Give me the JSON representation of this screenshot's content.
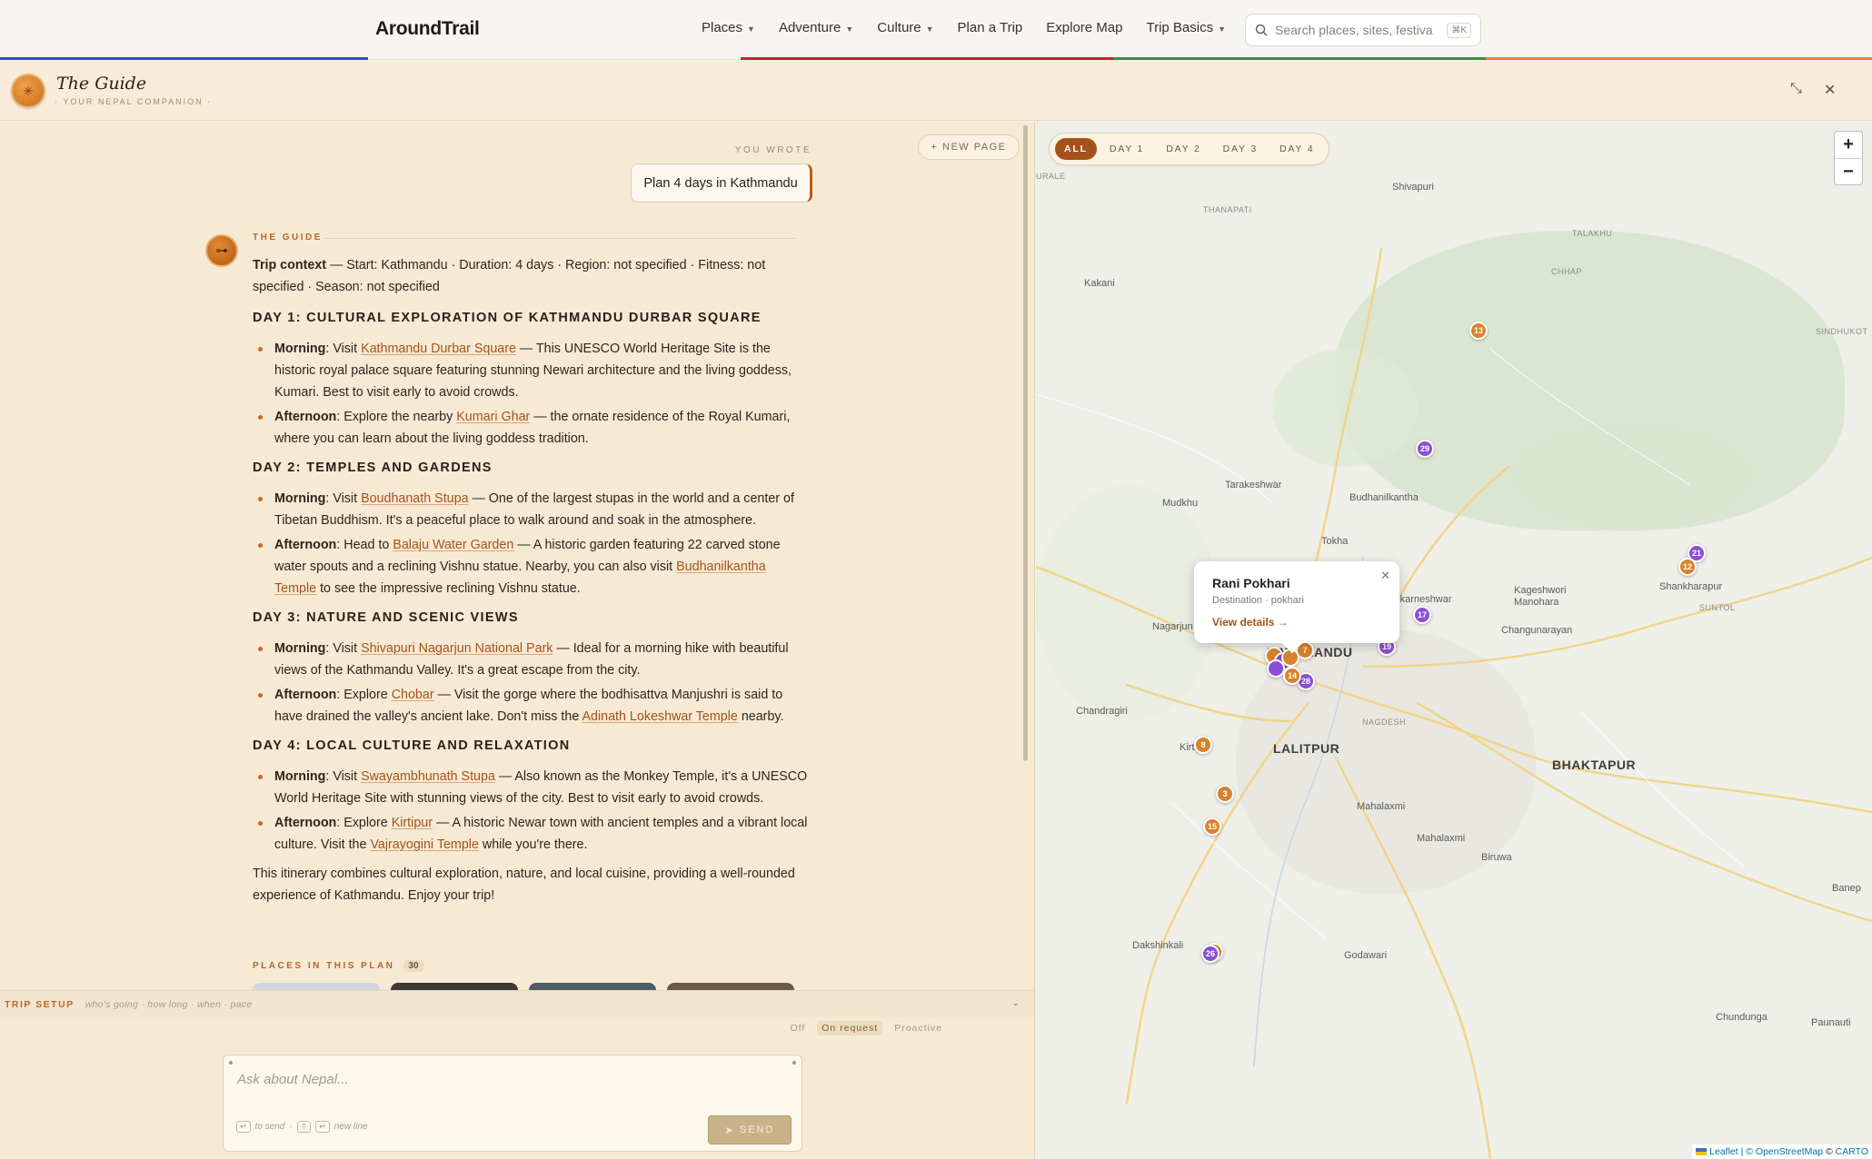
{
  "header": {
    "logo": "AroundTrail",
    "nav": [
      {
        "label": "Places",
        "dropdown": true
      },
      {
        "label": "Adventure",
        "dropdown": true
      },
      {
        "label": "Culture",
        "dropdown": true
      },
      {
        "label": "Plan a Trip",
        "dropdown": false
      },
      {
        "label": "Explore Map",
        "dropdown": false
      },
      {
        "label": "Trip Basics",
        "dropdown": true
      }
    ],
    "search_placeholder": "Search places, sites, festiva",
    "search_shortcut": "⌘K"
  },
  "guide_panel": {
    "title": "The Guide",
    "subtitle": "· YOUR NEPAL COMPANION ·",
    "new_page_label": "+ NEW PAGE",
    "you_wrote_label": "YOU WROTE",
    "user_message": "Plan 4 days in Kathmandu",
    "guide_label": "THE GUIDE"
  },
  "reply": {
    "context_label": "Trip context",
    "context_text": " — Start: Kathmandu · Duration: 4 days · Region: not specified · Fitness: not specified · Season: not specified",
    "days": [
      {
        "heading": "DAY 1: CULTURAL EXPLORATION OF KATHMANDU DURBAR SQUARE",
        "items": [
          {
            "when": "Morning",
            "pre": ": Visit ",
            "link": "Kathmandu Durbar Square",
            "post": " — This UNESCO World Heritage Site is the historic royal palace square featuring stunning Newari architecture and the living goddess, Kumari. Best to visit early to avoid crowds.",
            "link2": "",
            "post2": ""
          },
          {
            "when": "Afternoon",
            "pre": ": Explore the nearby ",
            "link": "Kumari Ghar",
            "post": " — the ornate residence of the Royal Kumari, where you can learn about the living goddess tradition.",
            "link2": "",
            "post2": ""
          }
        ]
      },
      {
        "heading": "DAY 2: TEMPLES AND GARDENS",
        "items": [
          {
            "when": "Morning",
            "pre": ": Visit ",
            "link": "Boudhanath Stupa",
            "post": " — One of the largest stupas in the world and a center of Tibetan Buddhism. It's a peaceful place to walk around and soak in the atmosphere.",
            "link2": "",
            "post2": ""
          },
          {
            "when": "Afternoon",
            "pre": ": Head to ",
            "link": "Balaju Water Garden",
            "post": " — A historic garden featuring 22 carved stone water spouts and a reclining Vishnu statue. Nearby, you can also visit ",
            "link2": "Budhanilkantha Temple",
            "post2": " to see the impressive reclining Vishnu statue."
          }
        ]
      },
      {
        "heading": "DAY 3: NATURE AND SCENIC VIEWS",
        "items": [
          {
            "when": "Morning",
            "pre": ": Visit ",
            "link": "Shivapuri Nagarjun National Park",
            "post": " — Ideal for a morning hike with beautiful views of the Kathmandu Valley. It's a great escape from the city.",
            "link2": "",
            "post2": ""
          },
          {
            "when": "Afternoon",
            "pre": ": Explore ",
            "link": "Chobar",
            "post": " — Visit the gorge where the bodhisattva Manjushri is said to have drained the valley's ancient lake. Don't miss the ",
            "link2": "Adinath Lokeshwar Temple",
            "post2": " nearby."
          }
        ]
      },
      {
        "heading": "DAY 4: LOCAL CULTURE AND RELAXATION",
        "items": [
          {
            "when": "Morning",
            "pre": ": Visit ",
            "link": "Swayambhunath Stupa",
            "post": " — Also known as the Monkey Temple, it's a UNESCO World Heritage Site with stunning views of the city. Best to visit early to avoid crowds.",
            "link2": "",
            "post2": ""
          },
          {
            "when": "Afternoon",
            "pre": ": Explore ",
            "link": "Kirtipur",
            "post": " — A historic Newar town with ancient temples and a vibrant local culture. Visit the ",
            "link2": "Vajrayogini Temple",
            "post2": " while you're there."
          }
        ]
      }
    ],
    "closing": "This itinerary combines cultural exploration, nature, and local cuisine, providing a well-rounded experience of Kathmandu. Enjoy your trip!",
    "places_label": "PLACES IN THIS PLAN",
    "places_count": "30"
  },
  "trip_setup": {
    "label": "TRIP SETUP",
    "hint": "who's going · how long · when · pace",
    "modes": [
      "Off",
      "On request",
      "Proactive"
    ],
    "active_mode": "On request"
  },
  "composer": {
    "placeholder": "Ask about Nepal...",
    "hint_send": "to send",
    "hint_newline": "new line",
    "send_label": "SEND"
  },
  "map": {
    "day_tabs": [
      "ALL",
      "DAY 1",
      "DAY 2",
      "DAY 3",
      "DAY 4"
    ],
    "active_tab": "ALL",
    "popup": {
      "title": "Rani Pokhari",
      "subtitle": "Destination · pokhari",
      "link": "View details →"
    },
    "labels": {
      "shivapuri": "Shivapuri",
      "thanapati": "THANAPATI",
      "talakhu": "TALAKHU",
      "chhap": "CHHAP",
      "kakani": "Kakani",
      "sindhukot": "SINDHUKOT",
      "tarakeshwar": "Tarakeshwar",
      "budhanilkantha": "Budhanilkantha",
      "mudkhu": "Mudkhu",
      "tokha": "Tokha",
      "gokarneshwar": "Gokarneshwar",
      "kageshwori": "Kageshwori Manohara",
      "shankharapur": "Shankharapur",
      "suntol": "SUNTOL",
      "changunarayan": "Changunarayan",
      "nagarjun": "Nagarjun",
      "kathmandu": "KATHMANDU",
      "chandragiri": "Chandragiri",
      "kirtipur": "Kirtipur",
      "lalitpur": "LALITPUR",
      "nagdesh": "NAGDESH",
      "bhaktapur": "BHAKTAPUR",
      "mahalaxmi1": "Mahalaxmi",
      "mahalaxmi2": "Mahalaxmi",
      "biruwa": "Biruwa",
      "dakshinkali": "Dakshinkali",
      "godawari": "Godawari",
      "chundunga": "Chundunga",
      "paunauti": "Paunauti",
      "banep": "Banep",
      "urale": "URALE"
    },
    "pins": [
      "13",
      "29",
      "21",
      "12",
      "17",
      "19",
      "7",
      "28",
      "14",
      "8",
      "3",
      "15",
      "26"
    ],
    "attribution_prefix": "Leaflet | © ",
    "attribution_osm": "OpenStreetMap",
    "attribution_carto": "CARTO",
    "colors": {
      "day_orange": "#d9822b",
      "day_purple": "#8a4fd6",
      "accent": "#a5521a"
    }
  }
}
